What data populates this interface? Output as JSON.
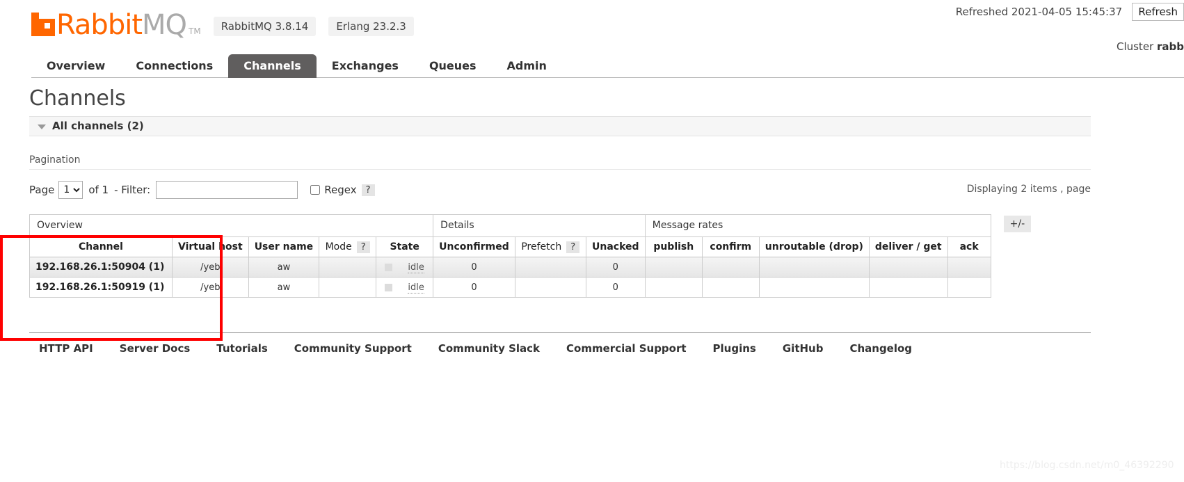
{
  "header": {
    "brand_rabbit": "Rabbit",
    "brand_mq": "MQ",
    "brand_tm": "TM",
    "version_rabbitmq": "RabbitMQ 3.8.14",
    "version_erlang": "Erlang 23.2.3",
    "refreshed_text": "Refreshed 2021-04-05 15:45:37",
    "refresh_button": "Refresh",
    "cluster_label": "Cluster",
    "cluster_name": "rabb"
  },
  "nav": {
    "items": [
      {
        "label": "Overview",
        "active": false
      },
      {
        "label": "Connections",
        "active": false
      },
      {
        "label": "Channels",
        "active": true
      },
      {
        "label": "Exchanges",
        "active": false
      },
      {
        "label": "Queues",
        "active": false
      },
      {
        "label": "Admin",
        "active": false
      }
    ]
  },
  "main": {
    "page_title": "Channels",
    "section_title": "All channels (2)",
    "pagination_title": "Pagination",
    "page_label": "Page",
    "page_value": "1",
    "page_options": [
      "1"
    ],
    "of_label": "of 1",
    "filter_label": "- Filter:",
    "filter_value": "",
    "filter_placeholder": "",
    "regex_label": "Regex",
    "regex_help": "?",
    "displaying": "Displaying 2 items , page",
    "plus_minus": "+/-"
  },
  "table": {
    "group_headers": [
      {
        "label": "Overview",
        "colspan": 5
      },
      {
        "label": "Details",
        "colspan": 3
      },
      {
        "label": "Message rates",
        "colspan": 5
      }
    ],
    "columns": [
      {
        "label": "Channel",
        "bold": true,
        "help": false
      },
      {
        "label": "Virtual host",
        "bold": true,
        "help": false
      },
      {
        "label": "User name",
        "bold": true,
        "help": false
      },
      {
        "label": "Mode",
        "bold": false,
        "help": true
      },
      {
        "label": "State",
        "bold": true,
        "help": false
      },
      {
        "label": "Unconfirmed",
        "bold": true,
        "help": false
      },
      {
        "label": "Prefetch",
        "bold": false,
        "help": true
      },
      {
        "label": "Unacked",
        "bold": true,
        "help": false
      },
      {
        "label": "publish",
        "bold": true,
        "help": false
      },
      {
        "label": "confirm",
        "bold": true,
        "help": false
      },
      {
        "label": "unroutable (drop)",
        "bold": true,
        "help": false
      },
      {
        "label": "deliver / get",
        "bold": true,
        "help": false
      },
      {
        "label": "ack",
        "bold": true,
        "help": false
      }
    ],
    "rows": [
      {
        "channel": "192.168.26.1:50904 (1)",
        "vhost": "/yeb",
        "user": "aw",
        "mode": "",
        "state": "idle",
        "unconfirmed": "0",
        "prefetch": "",
        "unacked": "0",
        "publish": "",
        "confirm": "",
        "unroutable": "",
        "deliver_get": "",
        "ack": ""
      },
      {
        "channel": "192.168.26.1:50919 (1)",
        "vhost": "/yeb",
        "user": "aw",
        "mode": "",
        "state": "idle",
        "unconfirmed": "0",
        "prefetch": "",
        "unacked": "0",
        "publish": "",
        "confirm": "",
        "unroutable": "",
        "deliver_get": "",
        "ack": ""
      }
    ]
  },
  "footer": {
    "links": [
      "HTTP API",
      "Server Docs",
      "Tutorials",
      "Community Support",
      "Community Slack",
      "Commercial Support",
      "Plugins",
      "GitHub",
      "Changelog"
    ]
  },
  "watermark": "https://blog.csdn.net/m0_46392290",
  "colors": {
    "brand_orange": "#ff6600",
    "brand_grey": "#aaaaaa",
    "active_tab_bg": "#605e5e",
    "annotation_red": "#fe0000"
  }
}
